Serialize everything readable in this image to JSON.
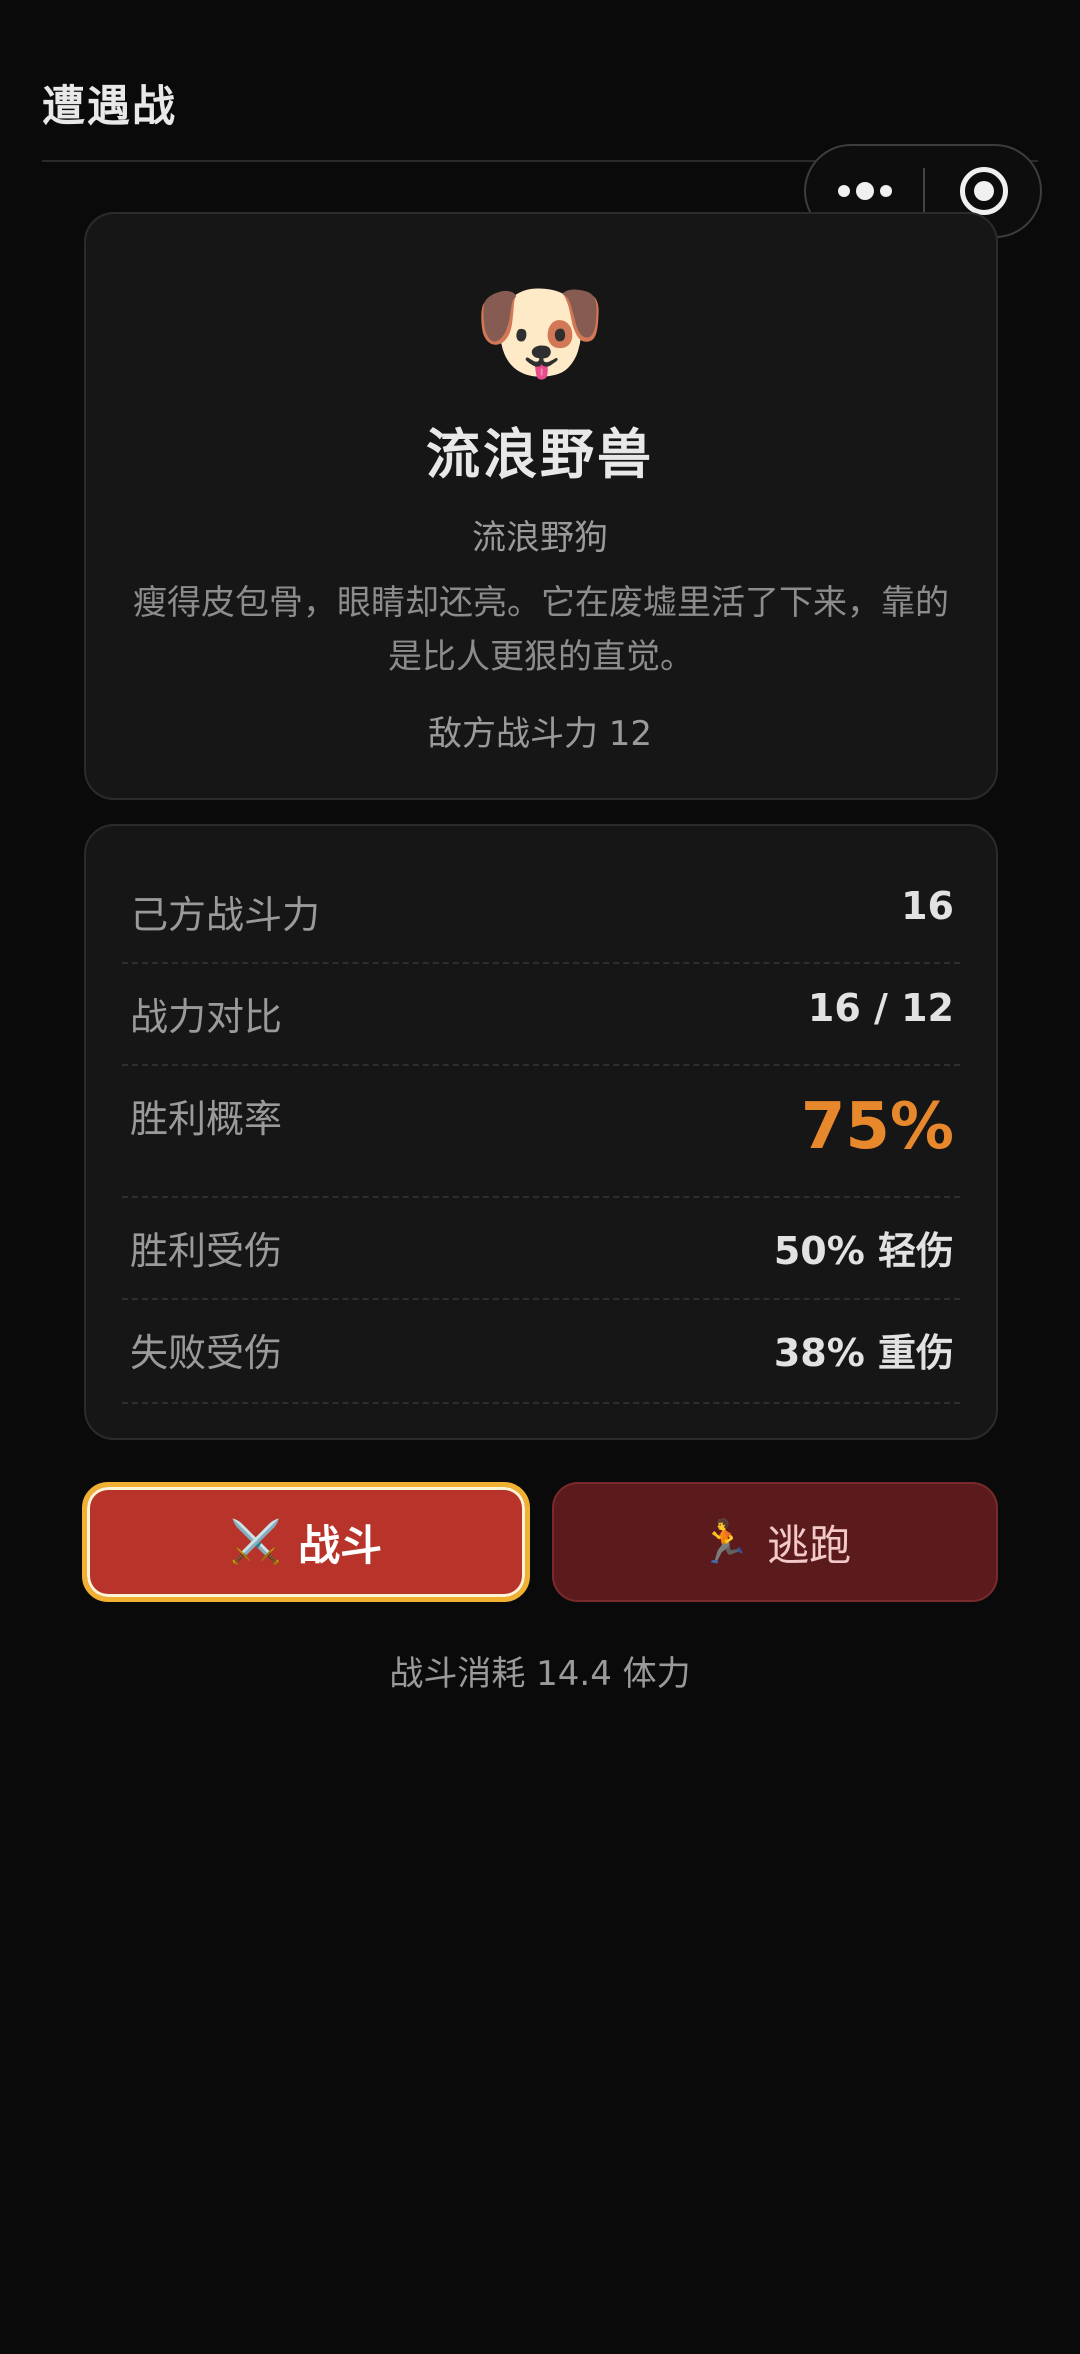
{
  "header": {
    "title": "遭遇战"
  },
  "capsule": {
    "more_icon": "more-dots-icon",
    "close_icon": "target-close-icon"
  },
  "enemy": {
    "emoji": "🐶",
    "name": "流浪野兽",
    "subtitle": "流浪野狗",
    "description": "瘦得皮包骨，眼睛却还亮。它在废墟里活了下来，靠的是比人更狠的直觉。",
    "power_text": "敌方战斗力 12"
  },
  "stats": [
    {
      "label": "己方战斗力",
      "value": "16"
    },
    {
      "label": "战力对比",
      "value": "16 / 12"
    },
    {
      "label": "胜利概率",
      "value": "75%",
      "color": "#e8882c"
    },
    {
      "label": "胜利受伤",
      "value": "50% 轻伤"
    },
    {
      "label": "失败受伤",
      "value": "38% 重伤"
    }
  ],
  "actions": {
    "fight": {
      "icon": "⚔️",
      "label": "战斗"
    },
    "flee": {
      "icon": "🏃",
      "label": "逃跑"
    }
  },
  "cost_text": "战斗消耗 14.4 体力"
}
